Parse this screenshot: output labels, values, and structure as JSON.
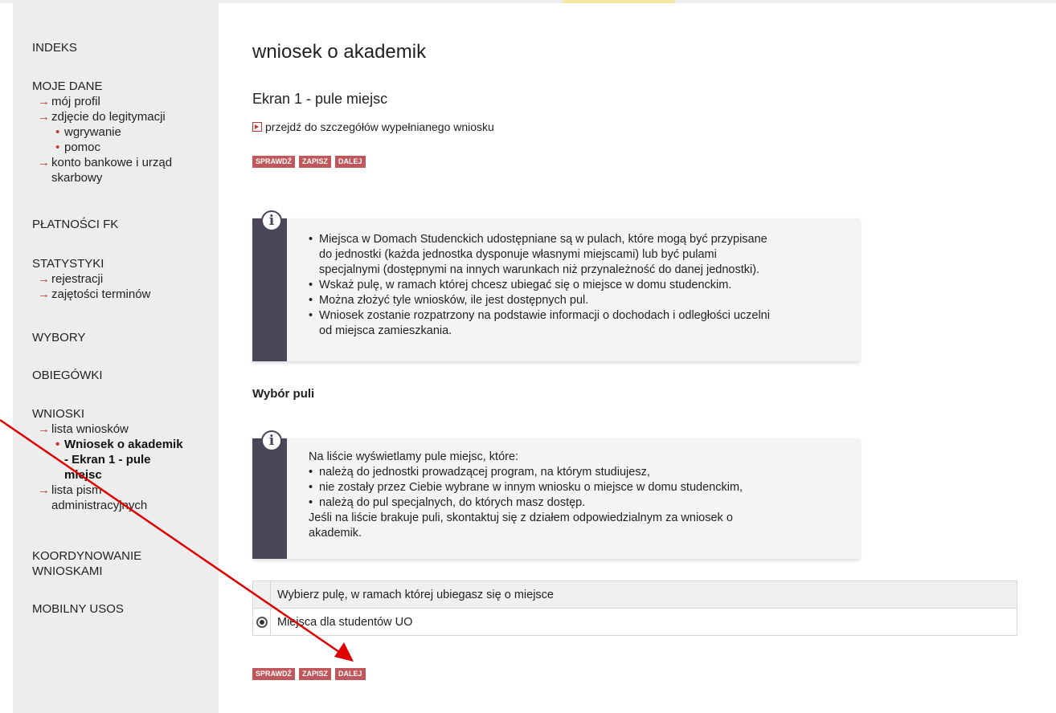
{
  "sidebar": {
    "indeks": "INDEKS",
    "moje_dane": {
      "label": "MOJE DANE",
      "items": [
        "mój profil",
        "zdjęcie do legitymacji",
        "konto bankowe i urząd",
        "skarbowy"
      ],
      "sub_items": [
        "wgrywanie",
        "pomoc"
      ]
    },
    "platnosci": "PŁATNOŚCI FK",
    "statystyki": {
      "label": "STATYSTYKI",
      "items": [
        "rejestracji",
        "zajętości terminów"
      ]
    },
    "wybory": "WYBORY",
    "obiegowki": "OBIEGÓWKI",
    "wnioski": {
      "label": "WNIOSKI",
      "items": [
        "lista wniosków",
        "lista pism",
        "administracyjnych"
      ],
      "active": [
        "Wniosek o akademik",
        "- Ekran 1 - pule",
        "miejsc"
      ]
    },
    "koordynowanie": [
      "KOORDYNOWANIE",
      "WNIOSKAMI"
    ],
    "mobilny": "MOBILNY USOS"
  },
  "main": {
    "title": "wniosek o akademik",
    "screen_title": "Ekran 1 - pule miejsc",
    "details_link": "przejdź do szczegółów wypełnianego wniosku",
    "buttons": {
      "check": "SPRAWDŹ",
      "save": "ZAPISZ",
      "next": "DALEJ"
    },
    "info1": [
      "Miejsca w Domach Studenckich udostępniane są w pulach, które mogą być przypisane",
      "do jednostki (każda jednostka dysponuje własnymi miejscami) lub być pulami",
      "specjalnymi (dostępnymi na innych warunkach niż przynależność do danej jednostki).",
      "Wskaż pulę, w ramach której chcesz ubiegać się o miejsce w domu studenckim.",
      "Można złożyć tyle wniosków, ile jest dostępnych pul.",
      "Wniosek zostanie rozpatrzony na podstawie informacji o dochodach i odległości uczelni",
      "od miejsca zamieszkania."
    ],
    "section_title": "Wybór puli",
    "info2": {
      "intro": "Na liście wyświetlamy pule miejsc, które:",
      "bullets": [
        "należą do jednostki prowadzącej program, na którym studiujesz,",
        "nie zostały przez Ciebie wybrane w innym wniosku o miejsce w domu studenckim,",
        "należą do pul specjalnych, do których masz dostęp."
      ],
      "outro": [
        "Jeśli na liście brakuje puli, skontaktuj się z działem odpowiedzialnym za wniosek o",
        "akademik."
      ]
    },
    "table": {
      "header": "Wybierz pulę, w ramach której ubiegasz się o miejsce",
      "option": "Miejsca dla studentów UO"
    }
  },
  "colors": {
    "accent": "#c0392b",
    "button": "#c0575a",
    "info_bar": "#4a4658",
    "sidebar_bg": "#ededed",
    "annotation": "#e00000"
  }
}
